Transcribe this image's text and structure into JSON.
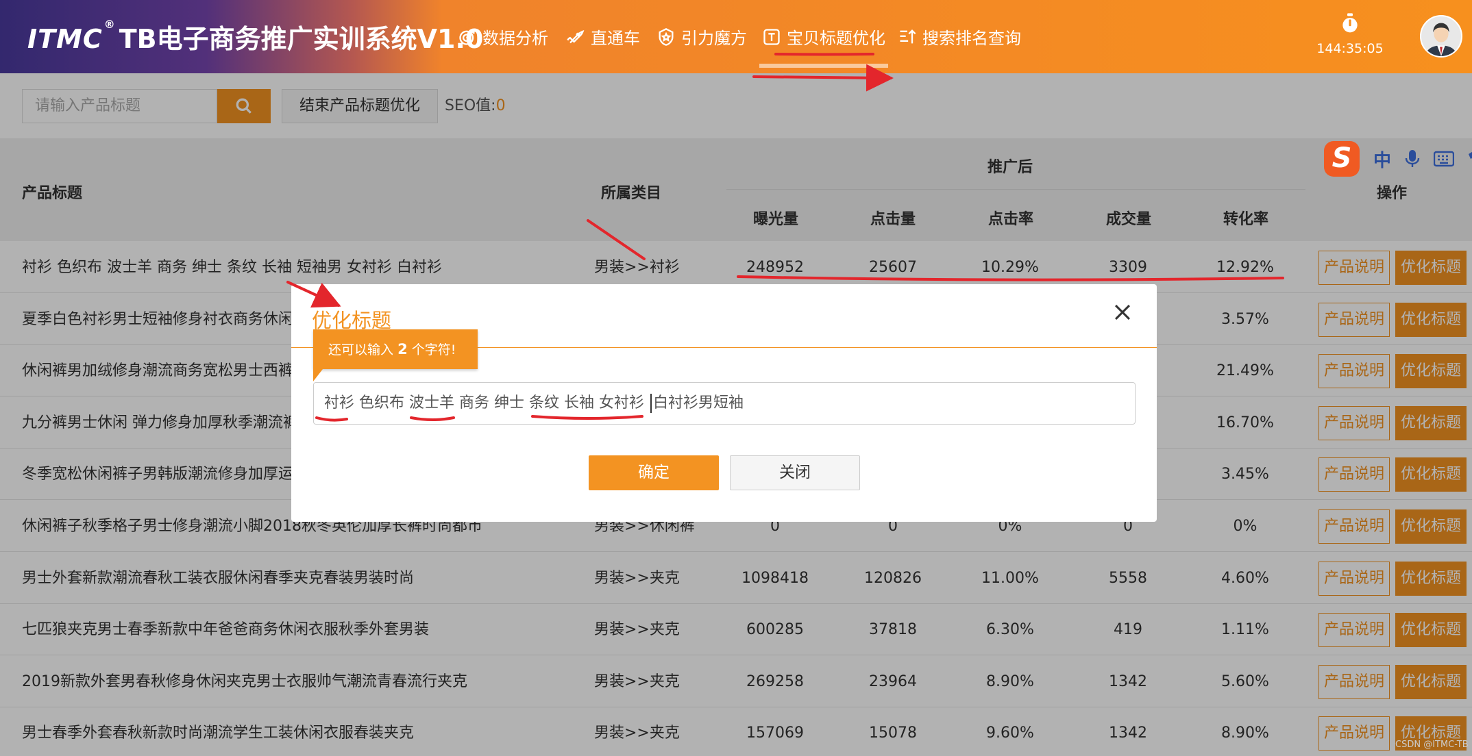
{
  "header": {
    "brand": "ITMC",
    "reg": "®",
    "title": "TB电子商务推广实训系统V1.0",
    "nav": [
      "数据分析",
      "直通车",
      "引力魔方",
      "宝贝标题优化",
      "搜索排名查询"
    ],
    "active_nav": "宝贝标题优化",
    "timer": "144:35:05"
  },
  "toolbar": {
    "search_placeholder": "请输入产品标题",
    "end_button": "结束产品标题优化",
    "seo_label": "SEO值:",
    "seo_value": "0"
  },
  "table": {
    "headers": {
      "title": "产品标题",
      "category": "所属类目",
      "after": "推广后",
      "exposure": "曝光量",
      "clicks": "点击量",
      "ctr": "点击率",
      "deals": "成交量",
      "conversion": "转化率",
      "ops": "操作"
    },
    "actions": {
      "describe": "产品说明",
      "optimize": "优化标题"
    },
    "rows": [
      {
        "title": "衬衫 色织布 波士羊 商务 绅士 条纹 长袖 短袖男 女衬衫 白衬衫",
        "category": "男装>>衬衫",
        "exposure": "248952",
        "clicks": "25607",
        "ctr": "10.29%",
        "deals": "3309",
        "conversion": "12.92%"
      },
      {
        "title": "夏季白色衬衫男士短袖修身衬衣商务休闲",
        "category": "",
        "exposure": "",
        "clicks": "",
        "ctr": "",
        "deals": "",
        "conversion": "3.57%"
      },
      {
        "title": "休闲裤男加绒修身潮流商务宽松男士西裤",
        "category": "",
        "exposure": "",
        "clicks": "",
        "ctr": "",
        "deals": "",
        "conversion": "21.49%"
      },
      {
        "title": "九分裤男士休闲 弹力修身加厚秋季潮流裤",
        "category": "",
        "exposure": "",
        "clicks": "",
        "ctr": "",
        "deals": "",
        "conversion": "16.70%"
      },
      {
        "title": "冬季宽松休闲裤子男韩版潮流修身加厚运",
        "category": "",
        "exposure": "",
        "clicks": "",
        "ctr": "",
        "deals": "",
        "conversion": "3.45%"
      },
      {
        "title": "休闲裤子秋季格子男士修身潮流小脚2018秋冬英伦加厚长裤时尚都市",
        "category": "男装>>休闲裤",
        "exposure": "0",
        "clicks": "0",
        "ctr": "0%",
        "deals": "0",
        "conversion": "0%"
      },
      {
        "title": "男士外套新款潮流春秋工装衣服休闲春季夹克春装男装时尚",
        "category": "男装>>夹克",
        "exposure": "1098418",
        "clicks": "120826",
        "ctr": "11.00%",
        "deals": "5558",
        "conversion": "4.60%"
      },
      {
        "title": "七匹狼夹克男士春季新款中年爸爸商务休闲衣服秋季外套男装",
        "category": "男装>>夹克",
        "exposure": "600285",
        "clicks": "37818",
        "ctr": "6.30%",
        "deals": "419",
        "conversion": "1.11%"
      },
      {
        "title": "2019新款外套男春秋修身休闲夹克男士衣服帅气潮流青春流行夹克",
        "category": "男装>>夹克",
        "exposure": "269258",
        "clicks": "23964",
        "ctr": "8.90%",
        "deals": "1342",
        "conversion": "5.60%"
      },
      {
        "title": "男士春季外套春秋新款时尚潮流学生工装休闲衣服春装夹克",
        "category": "男装>>夹克",
        "exposure": "157069",
        "clicks": "15078",
        "ctr": "9.60%",
        "deals": "1342",
        "conversion": "8.90%"
      }
    ]
  },
  "ime": {
    "lang": "中"
  },
  "dialog": {
    "title": "优化标题",
    "tip_prefix": "还可以输入",
    "tip_count": "2",
    "tip_suffix": "个字符!",
    "input_before": "衬衫 色织布 波士羊 商务 绅士 条纹 长袖 女衬衫 ",
    "input_after": "白衬衫男短袖",
    "ok": "确定",
    "close": "关闭"
  },
  "watermark": "CSDN @ITMC-TB",
  "colors": {
    "accent": "#f39322",
    "annotation": "#e3262c"
  }
}
